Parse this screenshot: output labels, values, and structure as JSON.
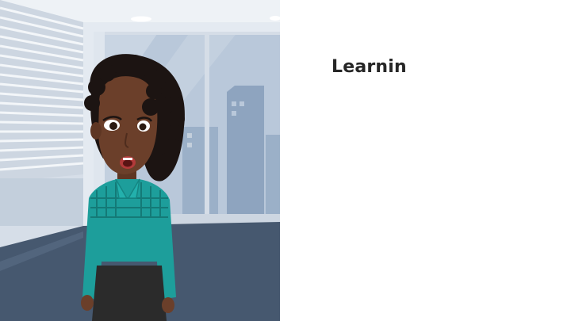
{
  "panel": {
    "heading": "Learnin"
  },
  "scene": {
    "description_icon": "office-window-scene",
    "character_icon": "woman-character",
    "colors": {
      "wall": "#dfe6ee",
      "sky": "#b9c8da",
      "buildings": "#8ea4bf",
      "floor": "#46586f",
      "shirt": "#1d9e9b",
      "skirt": "#2b2b2b",
      "skin": "#6b3f2a",
      "hair": "#1c1412"
    }
  }
}
